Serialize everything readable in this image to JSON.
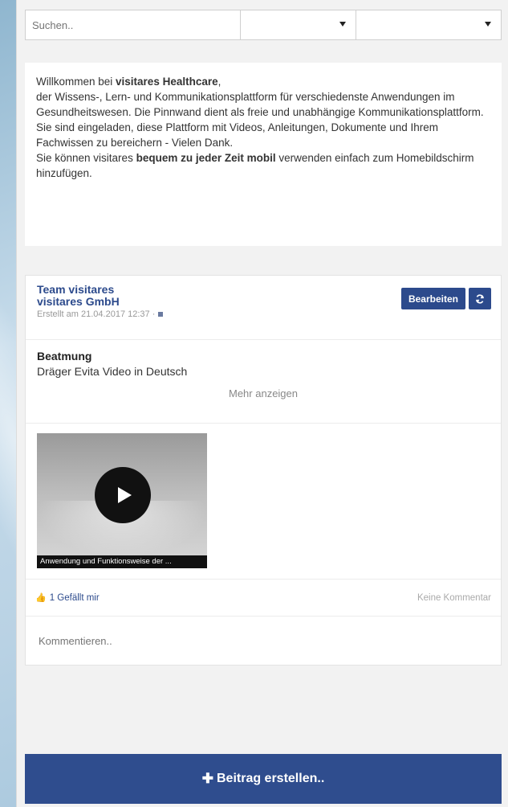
{
  "search": {
    "placeholder": "Suchen.."
  },
  "filters": {
    "select1": "",
    "select2": ""
  },
  "welcome": {
    "line1_prefix": "Willkommen bei ",
    "line1_brand": "visitares Healthcare",
    "line1_suffix": ",",
    "paragraph": "der Wissens-, Lern- und Kommunikationsplattform für verschiedenste Anwendungen im Gesundheitswesen. Die Pinnwand dient als freie und unabhängige Kommunikationsplattform. Sie sind eingeladen, diese Plattform mit Videos, Anleitungen, Dokumente und Ihrem Fachwissen zu bereichern - Vielen Dank.",
    "mobile_prefix": "Sie können visitares ",
    "mobile_bold": "bequem  zu jeder Zeit mobil",
    "mobile_suffix": " verwenden einfach zum Homebildschirm hinzufügen."
  },
  "post": {
    "author": "Team visitares",
    "company": "visitares GmbH",
    "date": "Erstellt am 21.04.2017 12:37 ·",
    "edit_label": "Bearbeiten",
    "refresh_icon": "refresh-icon",
    "title": "Beatmung",
    "subtitle": "Dräger Evita Video in Deutsch",
    "show_more": "Mehr anzeigen",
    "video_caption": "Anwendung und Funktionsweise der ...",
    "likes": "1 Gefällt mir",
    "comments": "Keine Kommentar",
    "comment_placeholder": "Kommentieren.."
  },
  "create_button": {
    "label": "Beitrag erstellen.."
  },
  "colors": {
    "accent": "#2c4a8c",
    "background": "#f2f2f2"
  }
}
